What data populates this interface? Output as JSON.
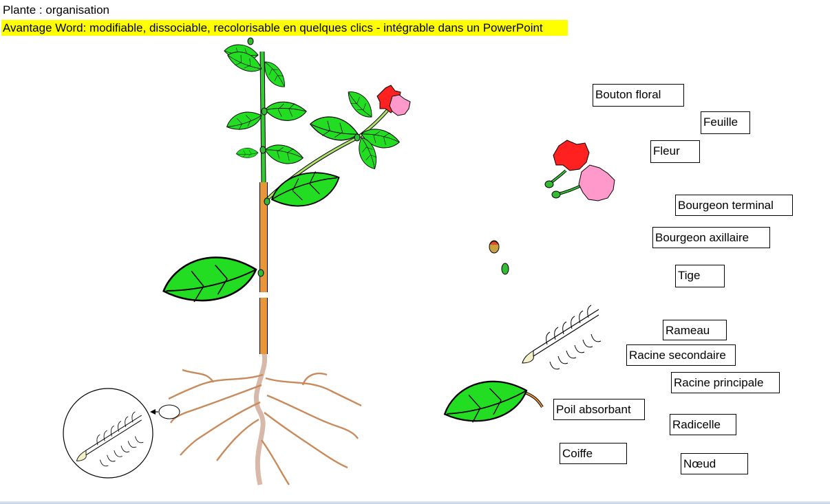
{
  "header": {
    "title": "Plante : organisation",
    "subtitle": "Avantage Word: modifiable, dissociable, recolorisable en quelques clics - intégrable dans un PowerPoint"
  },
  "labels": {
    "bouton_floral": "Bouton floral",
    "feuille": "Feuille",
    "fleur": "Fleur",
    "bourgeon_terminal": "Bourgeon terminal",
    "bourgeon_axillaire": "Bourgeon axillaire",
    "tige": "Tige",
    "rameau": "Rameau",
    "racine_secondaire": "Racine secondaire",
    "racine_principale": "Racine principale",
    "poil_absorbant": "Poil absorbant",
    "radicelle": "Radicelle",
    "coiffe": "Coiffe",
    "noeud": "Nœud"
  },
  "colors": {
    "highlight": "#ffff00",
    "leaf": "#22dd22",
    "stem_green": "#33cc33",
    "stem_brown": "#e8963a",
    "root": "#c88a5a",
    "flower_red": "#ff2020",
    "flower_pink": "#ff99cc",
    "root_cap": "#f3f0c8"
  }
}
